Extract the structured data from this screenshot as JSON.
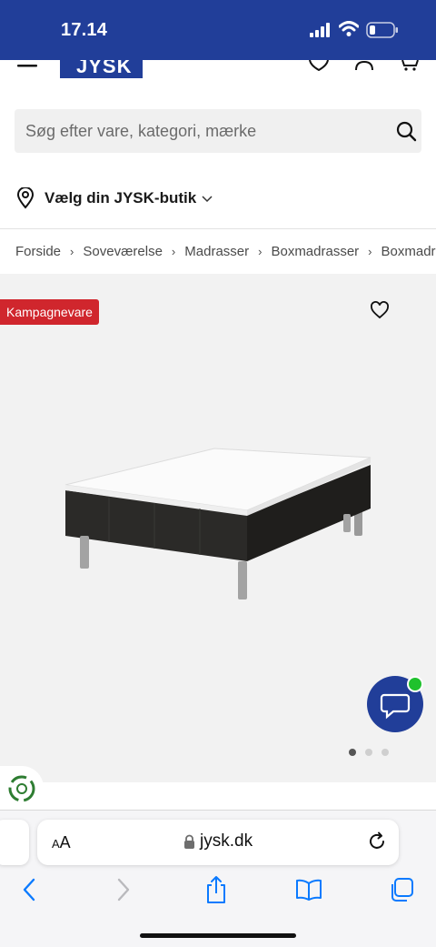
{
  "status_bar": {
    "time": "17.14"
  },
  "header": {
    "logo_text": "JYSK"
  },
  "search": {
    "placeholder": "Søg efter vare, kategori, mærke"
  },
  "store_selector": {
    "label": "Vælg din JYSK-butik"
  },
  "breadcrumb": [
    "Forside",
    "Soveværelse",
    "Madrasser",
    "Boxmadrasser",
    "Boxmadrasser"
  ],
  "product": {
    "badge": "Kampagnevare",
    "image_count": 3,
    "active_image": 1
  },
  "browser": {
    "text_size_label_small": "A",
    "text_size_label_large": "A",
    "url": "jysk.dk"
  },
  "colors": {
    "brand_blue": "#213e99",
    "badge_red": "#d0262d",
    "chat_online": "#1fc12d",
    "ios_blue": "#0a7aff"
  },
  "icons": [
    "menu-icon",
    "heart-icon",
    "user-icon",
    "cart-icon",
    "search-icon",
    "location-pin-icon",
    "chevron-down-icon",
    "chevron-right-icon",
    "chat-icon",
    "recycle-icon",
    "lock-icon",
    "reload-icon",
    "back-icon",
    "forward-icon",
    "share-icon",
    "bookmarks-icon",
    "tabs-icon"
  ]
}
